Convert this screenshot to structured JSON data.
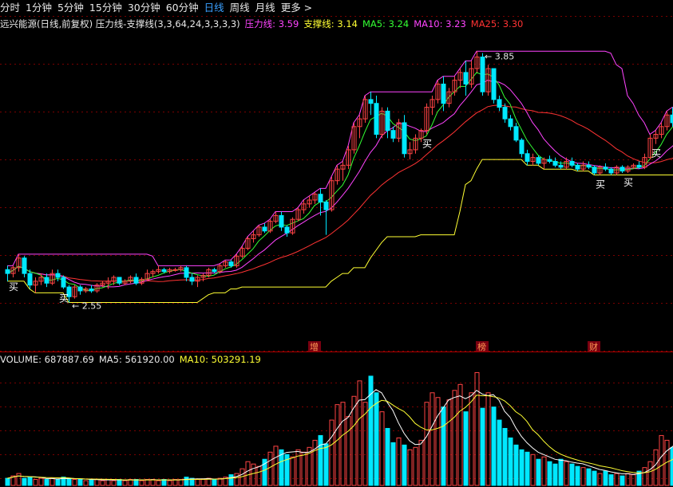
{
  "tabs": [
    {
      "label": "分时",
      "active": false
    },
    {
      "label": "1分钟",
      "active": false
    },
    {
      "label": "5分钟",
      "active": false
    },
    {
      "label": "15分钟",
      "active": false
    },
    {
      "label": "30分钟",
      "active": false
    },
    {
      "label": "60分钟",
      "active": false
    },
    {
      "label": "日线",
      "active": true
    },
    {
      "label": "周线",
      "active": false
    },
    {
      "label": "月线",
      "active": false
    },
    {
      "label": "更多 >",
      "active": false
    }
  ],
  "legend": {
    "title": "远兴能源(日线,前复权) 压力线-支撑线(3,3,64,24,3,3,3,3)",
    "items": [
      {
        "label": "压力线: 3.59",
        "color": "#ff44ff"
      },
      {
        "label": "支撑线: 3.14",
        "color": "#ffff33"
      },
      {
        "label": "MA5: 3.24",
        "color": "#33ff33"
      },
      {
        "label": "MA10: 3.23",
        "color": "#ff44ff"
      },
      {
        "label": "MA25: 3.30",
        "color": "#ff3333"
      }
    ]
  },
  "volume_legend": {
    "items": [
      {
        "label": "VOLUME: 687887.69",
        "color": "#e8e8e8"
      },
      {
        "label": "MA5: 561920.00",
        "color": "#e8e8e8"
      },
      {
        "label": "MA10: 503291.19",
        "color": "#ffff33"
      }
    ]
  },
  "colors": {
    "up": "#ff4444",
    "down": "#00e8ff",
    "pressure": "#ff44ff",
    "support": "#ffff33",
    "ma5": "#33ff33",
    "ma10": "#ff44ff",
    "ma25": "#ff3333",
    "grid": "#7a0000",
    "vol_ma5": "#ffffff",
    "vol_ma10": "#ffff33",
    "buy_text": "#ffffff"
  },
  "chart_data": {
    "type": "candlestick",
    "price_range": [
      2.35,
      3.95
    ],
    "high_marker": "3.85",
    "low_marker": "2.55",
    "buy_label": "买",
    "buy_signals": [
      1,
      10,
      75,
      106,
      111,
      116
    ],
    "event_tags": [
      {
        "index": 55,
        "label": "增"
      },
      {
        "index": 85,
        "label": "榜"
      },
      {
        "index": 105,
        "label": "财"
      }
    ],
    "candles": [
      [
        2.72,
        2.74,
        2.66,
        2.7
      ],
      [
        2.7,
        2.74,
        2.68,
        2.73
      ],
      [
        2.73,
        2.8,
        2.71,
        2.78
      ],
      [
        2.78,
        2.79,
        2.68,
        2.7
      ],
      [
        2.7,
        2.72,
        2.62,
        2.64
      ],
      [
        2.64,
        2.68,
        2.6,
        2.66
      ],
      [
        2.66,
        2.7,
        2.64,
        2.68
      ],
      [
        2.68,
        2.7,
        2.63,
        2.65
      ],
      [
        2.65,
        2.72,
        2.64,
        2.7
      ],
      [
        2.7,
        2.72,
        2.66,
        2.68
      ],
      [
        2.68,
        2.69,
        2.62,
        2.63
      ],
      [
        2.63,
        2.64,
        2.55,
        2.58
      ],
      [
        2.58,
        2.64,
        2.57,
        2.63
      ],
      [
        2.63,
        2.64,
        2.59,
        2.61
      ],
      [
        2.61,
        2.63,
        2.6,
        2.62
      ],
      [
        2.62,
        2.64,
        2.6,
        2.61
      ],
      [
        2.61,
        2.65,
        2.6,
        2.64
      ],
      [
        2.64,
        2.66,
        2.63,
        2.65
      ],
      [
        2.65,
        2.68,
        2.62,
        2.66
      ],
      [
        2.66,
        2.69,
        2.64,
        2.68
      ],
      [
        2.68,
        2.68,
        2.64,
        2.65
      ],
      [
        2.65,
        2.67,
        2.64,
        2.66
      ],
      [
        2.66,
        2.69,
        2.65,
        2.68
      ],
      [
        2.68,
        2.7,
        2.64,
        2.65
      ],
      [
        2.65,
        2.68,
        2.64,
        2.67
      ],
      [
        2.67,
        2.72,
        2.66,
        2.7
      ],
      [
        2.7,
        2.72,
        2.68,
        2.71
      ],
      [
        2.71,
        2.74,
        2.7,
        2.72
      ],
      [
        2.72,
        2.73,
        2.7,
        2.71
      ],
      [
        2.71,
        2.73,
        2.7,
        2.72
      ],
      [
        2.72,
        2.73,
        2.71,
        2.72
      ],
      [
        2.72,
        2.74,
        2.71,
        2.73
      ],
      [
        2.73,
        2.74,
        2.66,
        2.68
      ],
      [
        2.68,
        2.7,
        2.64,
        2.66
      ],
      [
        2.66,
        2.69,
        2.63,
        2.68
      ],
      [
        2.68,
        2.7,
        2.66,
        2.69
      ],
      [
        2.69,
        2.73,
        2.68,
        2.72
      ],
      [
        2.72,
        2.73,
        2.7,
        2.71
      ],
      [
        2.71,
        2.75,
        2.7,
        2.74
      ],
      [
        2.74,
        2.77,
        2.73,
        2.76
      ],
      [
        2.76,
        2.77,
        2.73,
        2.74
      ],
      [
        2.74,
        2.8,
        2.73,
        2.79
      ],
      [
        2.79,
        2.84,
        2.78,
        2.83
      ],
      [
        2.83,
        2.89,
        2.82,
        2.88
      ],
      [
        2.88,
        2.92,
        2.86,
        2.9
      ],
      [
        2.9,
        2.95,
        2.89,
        2.94
      ],
      [
        2.94,
        2.96,
        2.91,
        2.92
      ],
      [
        2.92,
        2.98,
        2.91,
        2.97
      ],
      [
        2.97,
        3.02,
        2.96,
        3.0
      ],
      [
        3.0,
        3.02,
        2.92,
        2.94
      ],
      [
        2.94,
        2.95,
        2.89,
        2.91
      ],
      [
        2.91,
        2.99,
        2.9,
        2.98
      ],
      [
        2.98,
        3.04,
        2.97,
        3.03
      ],
      [
        3.03,
        3.08,
        3.01,
        3.06
      ],
      [
        3.06,
        3.1,
        3.04,
        3.08
      ],
      [
        3.08,
        3.12,
        3.06,
        3.11
      ],
      [
        3.11,
        3.14,
        3.0,
        3.07
      ],
      [
        3.07,
        3.08,
        2.9,
        3.03
      ],
      [
        3.03,
        3.2,
        3.02,
        3.18
      ],
      [
        3.18,
        3.26,
        3.16,
        3.24
      ],
      [
        3.24,
        3.28,
        3.18,
        3.26
      ],
      [
        3.26,
        3.36,
        3.24,
        3.34
      ],
      [
        3.34,
        3.48,
        3.32,
        3.46
      ],
      [
        3.46,
        3.52,
        3.4,
        3.5
      ],
      [
        3.5,
        3.62,
        3.48,
        3.6
      ],
      [
        3.6,
        3.64,
        3.52,
        3.58
      ],
      [
        3.58,
        3.62,
        3.4,
        3.42
      ],
      [
        3.42,
        3.56,
        3.4,
        3.54
      ],
      [
        3.54,
        3.56,
        3.4,
        3.44
      ],
      [
        3.44,
        3.46,
        3.38,
        3.4
      ],
      [
        3.4,
        3.5,
        3.38,
        3.48
      ],
      [
        3.48,
        3.52,
        3.3,
        3.32
      ],
      [
        3.32,
        3.38,
        3.29,
        3.34
      ],
      [
        3.34,
        3.42,
        3.32,
        3.4
      ],
      [
        3.4,
        3.45,
        3.38,
        3.44
      ],
      [
        3.44,
        3.58,
        3.42,
        3.56
      ],
      [
        3.56,
        3.62,
        3.52,
        3.6
      ],
      [
        3.6,
        3.7,
        3.58,
        3.68
      ],
      [
        3.68,
        3.72,
        3.54,
        3.58
      ],
      [
        3.58,
        3.66,
        3.56,
        3.64
      ],
      [
        3.64,
        3.72,
        3.62,
        3.7
      ],
      [
        3.7,
        3.76,
        3.66,
        3.74
      ],
      [
        3.74,
        3.8,
        3.62,
        3.68
      ],
      [
        3.68,
        3.8,
        3.66,
        3.76
      ],
      [
        3.76,
        3.85,
        3.74,
        3.82
      ],
      [
        3.82,
        3.84,
        3.62,
        3.64
      ],
      [
        3.64,
        3.78,
        3.62,
        3.76
      ],
      [
        3.76,
        3.76,
        3.58,
        3.6
      ],
      [
        3.6,
        3.62,
        3.54,
        3.56
      ],
      [
        3.56,
        3.58,
        3.48,
        3.5
      ],
      [
        3.5,
        3.52,
        3.44,
        3.46
      ],
      [
        3.46,
        3.48,
        3.38,
        3.39
      ],
      [
        3.39,
        3.4,
        3.3,
        3.32
      ],
      [
        3.32,
        3.34,
        3.26,
        3.28
      ],
      [
        3.28,
        3.32,
        3.26,
        3.3
      ],
      [
        3.3,
        3.31,
        3.26,
        3.27
      ],
      [
        3.27,
        3.3,
        3.24,
        3.29
      ],
      [
        3.29,
        3.31,
        3.27,
        3.28
      ],
      [
        3.28,
        3.3,
        3.25,
        3.26
      ],
      [
        3.26,
        3.28,
        3.24,
        3.25
      ],
      [
        3.25,
        3.3,
        3.24,
        3.28
      ],
      [
        3.28,
        3.3,
        3.25,
        3.26
      ],
      [
        3.26,
        3.27,
        3.23,
        3.24
      ],
      [
        3.24,
        3.28,
        3.23,
        3.26
      ],
      [
        3.26,
        3.28,
        3.24,
        3.25
      ],
      [
        3.25,
        3.26,
        3.21,
        3.22
      ],
      [
        3.22,
        3.26,
        3.21,
        3.25
      ],
      [
        3.25,
        3.27,
        3.23,
        3.24
      ],
      [
        3.24,
        3.25,
        3.21,
        3.22
      ],
      [
        3.22,
        3.26,
        3.21,
        3.25
      ],
      [
        3.25,
        3.26,
        3.22,
        3.23
      ],
      [
        3.23,
        3.26,
        3.22,
        3.25
      ],
      [
        3.25,
        3.27,
        3.24,
        3.26
      ],
      [
        3.26,
        3.28,
        3.24,
        3.25
      ],
      [
        3.25,
        3.32,
        3.24,
        3.3
      ],
      [
        3.3,
        3.42,
        3.29,
        3.4
      ],
      [
        3.4,
        3.44,
        3.37,
        3.42
      ],
      [
        3.42,
        3.48,
        3.4,
        3.46
      ],
      [
        3.46,
        3.54,
        3.44,
        3.52
      ],
      [
        3.52,
        3.56,
        3.46,
        3.48
      ],
      [
        3.48,
        3.56,
        3.46,
        3.54
      ]
    ],
    "volumes": [
      0.06,
      0.08,
      0.1,
      0.06,
      0.07,
      0.05,
      0.06,
      0.05,
      0.06,
      0.05,
      0.07,
      0.06,
      0.05,
      0.05,
      0.04,
      0.05,
      0.05,
      0.04,
      0.05,
      0.04,
      0.05,
      0.04,
      0.05,
      0.05,
      0.04,
      0.05,
      0.05,
      0.04,
      0.05,
      0.04,
      0.05,
      0.05,
      0.07,
      0.06,
      0.05,
      0.05,
      0.06,
      0.05,
      0.06,
      0.07,
      0.09,
      0.1,
      0.14,
      0.2,
      0.18,
      0.16,
      0.22,
      0.28,
      0.33,
      0.3,
      0.26,
      0.24,
      0.3,
      0.28,
      0.32,
      0.38,
      0.42,
      0.35,
      0.55,
      0.68,
      0.7,
      0.58,
      0.75,
      0.88,
      0.7,
      0.92,
      0.78,
      0.62,
      0.48,
      0.36,
      0.4,
      0.34,
      0.3,
      0.32,
      0.38,
      0.7,
      0.78,
      0.74,
      0.66,
      0.72,
      0.8,
      0.85,
      0.62,
      0.78,
      0.95,
      0.65,
      0.78,
      0.66,
      0.55,
      0.48,
      0.4,
      0.34,
      0.3,
      0.28,
      0.26,
      0.22,
      0.24,
      0.2,
      0.18,
      0.22,
      0.2,
      0.18,
      0.16,
      0.15,
      0.14,
      0.12,
      0.1,
      0.12,
      0.09,
      0.1,
      0.08,
      0.1,
      0.09,
      0.12,
      0.15,
      0.2,
      0.3,
      0.42,
      0.38,
      0.32,
      0.44
    ]
  }
}
